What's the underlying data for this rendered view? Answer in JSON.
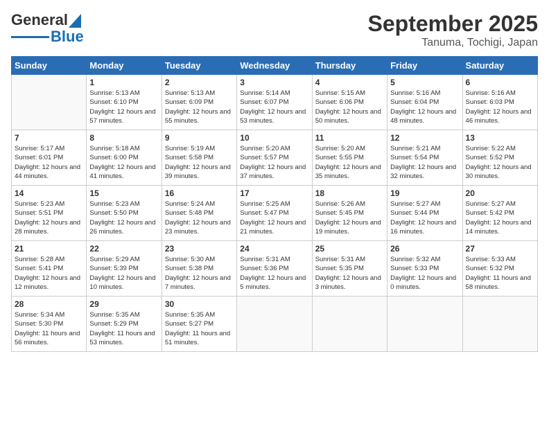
{
  "logo": {
    "line1": "General",
    "line2": "Blue"
  },
  "title": "September 2025",
  "subtitle": "Tanuma, Tochigi, Japan",
  "weekdays": [
    "Sunday",
    "Monday",
    "Tuesday",
    "Wednesday",
    "Thursday",
    "Friday",
    "Saturday"
  ],
  "weeks": [
    [
      {
        "day": "",
        "sunrise": "",
        "sunset": "",
        "daylight": ""
      },
      {
        "day": "1",
        "sunrise": "5:13 AM",
        "sunset": "6:10 PM",
        "daylight": "12 hours and 57 minutes."
      },
      {
        "day": "2",
        "sunrise": "5:13 AM",
        "sunset": "6:09 PM",
        "daylight": "12 hours and 55 minutes."
      },
      {
        "day": "3",
        "sunrise": "5:14 AM",
        "sunset": "6:07 PM",
        "daylight": "12 hours and 53 minutes."
      },
      {
        "day": "4",
        "sunrise": "5:15 AM",
        "sunset": "6:06 PM",
        "daylight": "12 hours and 50 minutes."
      },
      {
        "day": "5",
        "sunrise": "5:16 AM",
        "sunset": "6:04 PM",
        "daylight": "12 hours and 48 minutes."
      },
      {
        "day": "6",
        "sunrise": "5:16 AM",
        "sunset": "6:03 PM",
        "daylight": "12 hours and 46 minutes."
      }
    ],
    [
      {
        "day": "7",
        "sunrise": "5:17 AM",
        "sunset": "6:01 PM",
        "daylight": "12 hours and 44 minutes."
      },
      {
        "day": "8",
        "sunrise": "5:18 AM",
        "sunset": "6:00 PM",
        "daylight": "12 hours and 41 minutes."
      },
      {
        "day": "9",
        "sunrise": "5:19 AM",
        "sunset": "5:58 PM",
        "daylight": "12 hours and 39 minutes."
      },
      {
        "day": "10",
        "sunrise": "5:20 AM",
        "sunset": "5:57 PM",
        "daylight": "12 hours and 37 minutes."
      },
      {
        "day": "11",
        "sunrise": "5:20 AM",
        "sunset": "5:55 PM",
        "daylight": "12 hours and 35 minutes."
      },
      {
        "day": "12",
        "sunrise": "5:21 AM",
        "sunset": "5:54 PM",
        "daylight": "12 hours and 32 minutes."
      },
      {
        "day": "13",
        "sunrise": "5:22 AM",
        "sunset": "5:52 PM",
        "daylight": "12 hours and 30 minutes."
      }
    ],
    [
      {
        "day": "14",
        "sunrise": "5:23 AM",
        "sunset": "5:51 PM",
        "daylight": "12 hours and 28 minutes."
      },
      {
        "day": "15",
        "sunrise": "5:23 AM",
        "sunset": "5:50 PM",
        "daylight": "12 hours and 26 minutes."
      },
      {
        "day": "16",
        "sunrise": "5:24 AM",
        "sunset": "5:48 PM",
        "daylight": "12 hours and 23 minutes."
      },
      {
        "day": "17",
        "sunrise": "5:25 AM",
        "sunset": "5:47 PM",
        "daylight": "12 hours and 21 minutes."
      },
      {
        "day": "18",
        "sunrise": "5:26 AM",
        "sunset": "5:45 PM",
        "daylight": "12 hours and 19 minutes."
      },
      {
        "day": "19",
        "sunrise": "5:27 AM",
        "sunset": "5:44 PM",
        "daylight": "12 hours and 16 minutes."
      },
      {
        "day": "20",
        "sunrise": "5:27 AM",
        "sunset": "5:42 PM",
        "daylight": "12 hours and 14 minutes."
      }
    ],
    [
      {
        "day": "21",
        "sunrise": "5:28 AM",
        "sunset": "5:41 PM",
        "daylight": "12 hours and 12 minutes."
      },
      {
        "day": "22",
        "sunrise": "5:29 AM",
        "sunset": "5:39 PM",
        "daylight": "12 hours and 10 minutes."
      },
      {
        "day": "23",
        "sunrise": "5:30 AM",
        "sunset": "5:38 PM",
        "daylight": "12 hours and 7 minutes."
      },
      {
        "day": "24",
        "sunrise": "5:31 AM",
        "sunset": "5:36 PM",
        "daylight": "12 hours and 5 minutes."
      },
      {
        "day": "25",
        "sunrise": "5:31 AM",
        "sunset": "5:35 PM",
        "daylight": "12 hours and 3 minutes."
      },
      {
        "day": "26",
        "sunrise": "5:32 AM",
        "sunset": "5:33 PM",
        "daylight": "12 hours and 0 minutes."
      },
      {
        "day": "27",
        "sunrise": "5:33 AM",
        "sunset": "5:32 PM",
        "daylight": "11 hours and 58 minutes."
      }
    ],
    [
      {
        "day": "28",
        "sunrise": "5:34 AM",
        "sunset": "5:30 PM",
        "daylight": "11 hours and 56 minutes."
      },
      {
        "day": "29",
        "sunrise": "5:35 AM",
        "sunset": "5:29 PM",
        "daylight": "11 hours and 53 minutes."
      },
      {
        "day": "30",
        "sunrise": "5:35 AM",
        "sunset": "5:27 PM",
        "daylight": "11 hours and 51 minutes."
      },
      {
        "day": "",
        "sunrise": "",
        "sunset": "",
        "daylight": ""
      },
      {
        "day": "",
        "sunrise": "",
        "sunset": "",
        "daylight": ""
      },
      {
        "day": "",
        "sunrise": "",
        "sunset": "",
        "daylight": ""
      },
      {
        "day": "",
        "sunrise": "",
        "sunset": "",
        "daylight": ""
      }
    ]
  ]
}
